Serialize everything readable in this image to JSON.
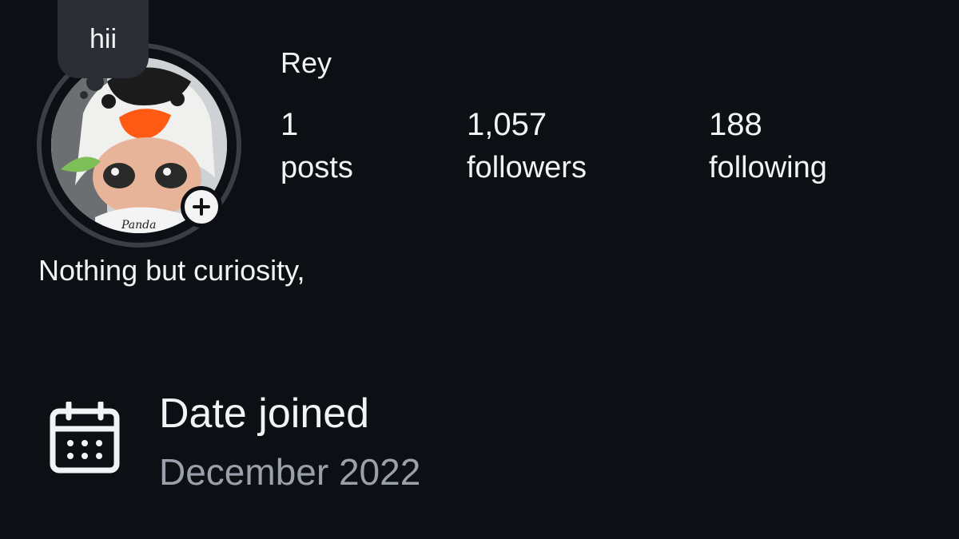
{
  "note": {
    "text": "hii"
  },
  "profile": {
    "name": "Rey",
    "bio": "Nothing but curiosity,",
    "avatar_text": "Panda"
  },
  "stats": {
    "posts": {
      "value": "1",
      "label": "posts"
    },
    "followers": {
      "value": "1,057",
      "label": "followers"
    },
    "following": {
      "value": "188",
      "label": "following"
    }
  },
  "about": {
    "date_joined_label": "Date joined",
    "date_joined_value": "December 2022",
    "icon": "calendar-icon"
  },
  "colors": {
    "background": "#0c0f14",
    "text_primary": "#f2f3f5",
    "text_secondary": "#9aa1aa",
    "note_bubble": "#2a2d33",
    "avatar_ring": "#3a3e45"
  }
}
